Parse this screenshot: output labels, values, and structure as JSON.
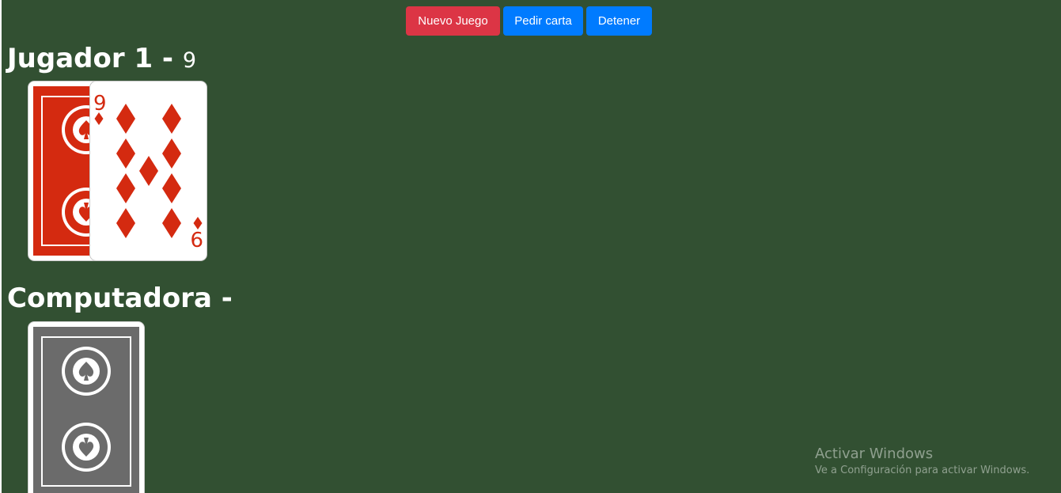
{
  "toolbar": {
    "new_game_label": "Nuevo Juego",
    "draw_card_label": "Pedir carta",
    "stop_label": "Detener"
  },
  "player": {
    "title": "Jugador 1 - ",
    "score": "9",
    "cards": [
      {
        "kind": "back",
        "color": "red"
      },
      {
        "kind": "face",
        "rank": "9",
        "suit": "diamonds"
      }
    ]
  },
  "computer": {
    "title": "Computadora - ",
    "score": "",
    "cards": [
      {
        "kind": "back",
        "color": "gray"
      }
    ]
  },
  "watermark": {
    "title": "Activar Windows",
    "subtitle": "Ve a Configuración para activar Windows."
  },
  "colors": {
    "table_felt": "#325032",
    "danger": "#dc3545",
    "primary": "#007bff",
    "card_back_red": "#d42a10",
    "card_back_gray": "#6b6b6b",
    "diamond_red": "#d42a10"
  }
}
